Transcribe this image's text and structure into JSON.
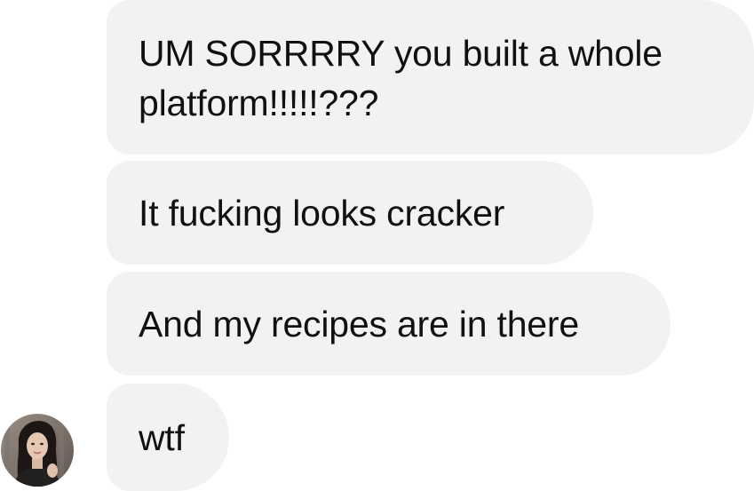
{
  "messages": [
    {
      "text": "UM SORRRRY you built a whole platform!!!!!???"
    },
    {
      "text": "It fucking looks cracker"
    },
    {
      "text": "And my recipes are in there"
    },
    {
      "text": "wtf"
    }
  ],
  "sender": {
    "avatar_icon": "user-photo-avatar"
  },
  "colors": {
    "bubble_background": "#f1f2f4",
    "text": "#111111"
  }
}
